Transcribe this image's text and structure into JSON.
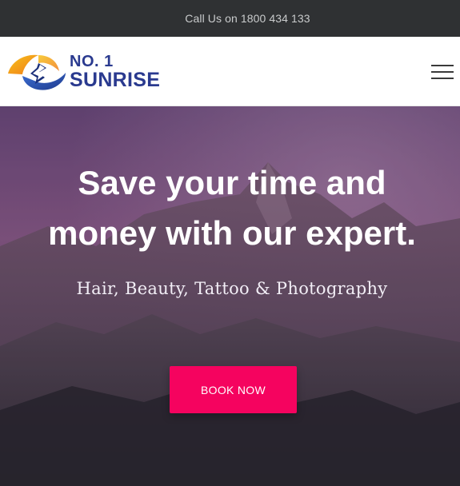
{
  "topbar": {
    "call_text": "Call Us on 1800 434 133"
  },
  "header": {
    "logo": {
      "line1": "NO. 1",
      "line2": "SUNRISE"
    },
    "menu_icon": "hamburger-menu-icon"
  },
  "hero": {
    "title_line1": "Save your time and",
    "title_line2": "money with our expert.",
    "subtitle": "Hair, Beauty, Tattoo & Photography",
    "cta_label": "BOOK NOW"
  },
  "colors": {
    "topbar_bg": "#2f3133",
    "cta": "#f5035f",
    "logo_text": "#2a3a8f",
    "logo_orange": "#f3a21b",
    "logo_blue": "#2a4aa5"
  }
}
